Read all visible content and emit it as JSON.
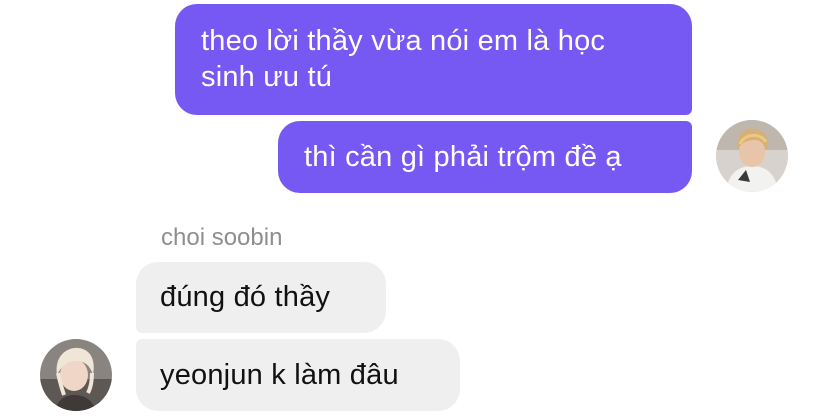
{
  "chat": {
    "messages": [
      {
        "direction": "outgoing",
        "text": "theo lời thầy vừa nói em là học sinh ưu tú"
      },
      {
        "direction": "outgoing",
        "text": "thì cần gì phải trộm đề ạ"
      },
      {
        "direction": "incoming",
        "text": "đúng đó thầy"
      },
      {
        "direction": "incoming",
        "text": "yeonjun k làm đâu"
      }
    ],
    "incoming_sender": "choi soobin"
  },
  "colors": {
    "outgoing_bubble": "#7559f2",
    "incoming_bubble": "#efefef",
    "sender_label": "#8e8e8e"
  },
  "icons": {
    "self_avatar": "user-avatar-icon",
    "contact_avatar": "contact-avatar-icon"
  }
}
